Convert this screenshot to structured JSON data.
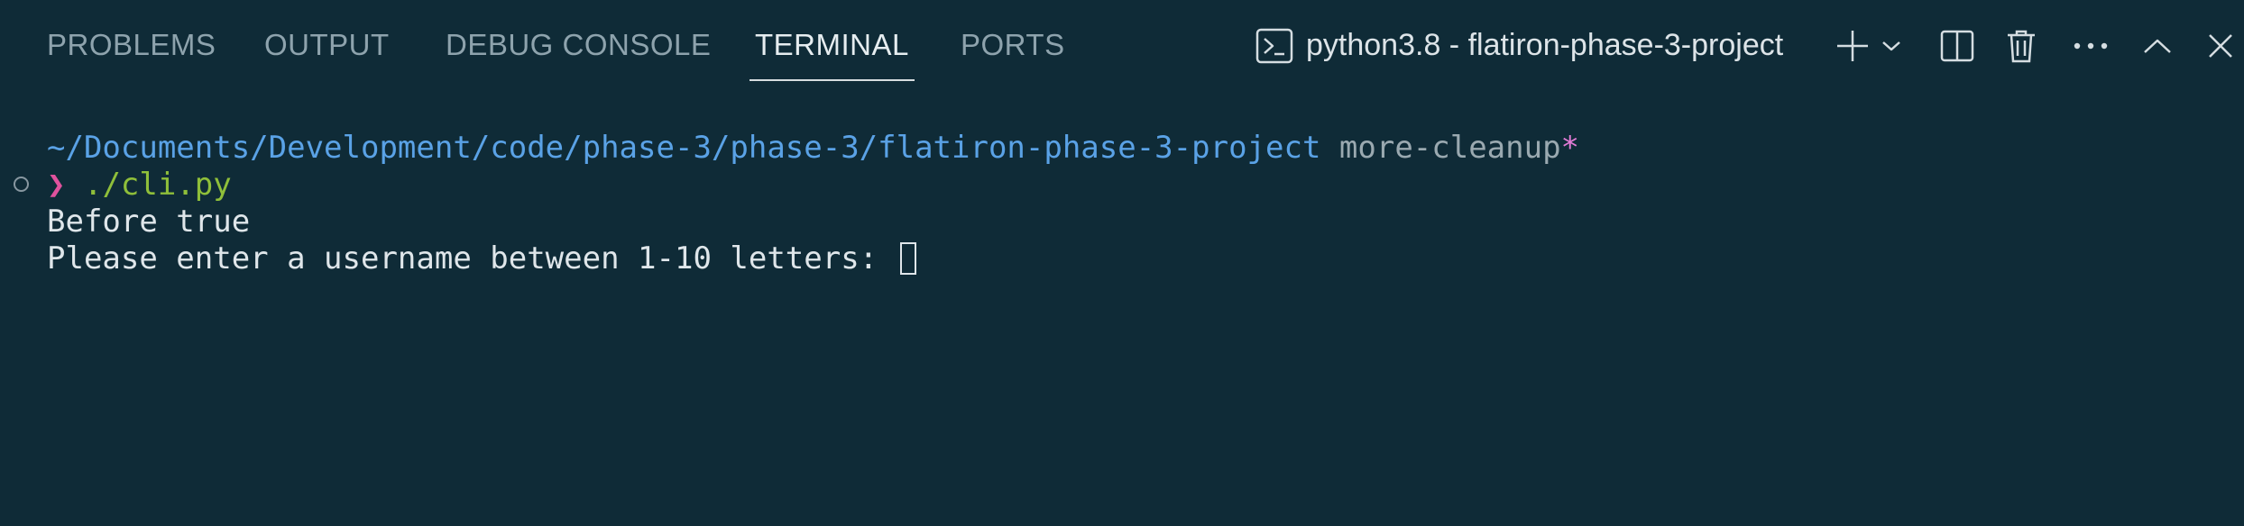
{
  "panel": {
    "tabs": [
      {
        "label": "PROBLEMS",
        "active": false
      },
      {
        "label": "OUTPUT",
        "active": false
      },
      {
        "label": "DEBUG CONSOLE",
        "active": false
      },
      {
        "label": "TERMINAL",
        "active": true
      },
      {
        "label": "PORTS",
        "active": false
      }
    ],
    "terminal_name": "python3.8 - flatiron-phase-3-project",
    "icons": {
      "terminal": "terminal-icon",
      "new": "plus-icon",
      "dropdown": "chevron-down-icon",
      "split": "split-icon",
      "kill": "trash-icon",
      "more": "ellipsis-icon",
      "maximize": "chevron-up-icon",
      "close": "close-icon"
    }
  },
  "terminal": {
    "cwd": "~/Documents/Development/code/phase-3/phase-3/flatiron-phase-3-project",
    "branch": "more-cleanup",
    "dirty_marker": "*",
    "prompt_symbol": "❯",
    "command": "./cli.py",
    "output_lines": [
      "Before true",
      "Please enter a username between 1-10 letters: "
    ]
  },
  "colors": {
    "background": "#0f2b37",
    "path": "#5aa2e6",
    "prompt": "#e0529d",
    "command": "#8fbf3a",
    "dirty": "#e27bd6"
  }
}
